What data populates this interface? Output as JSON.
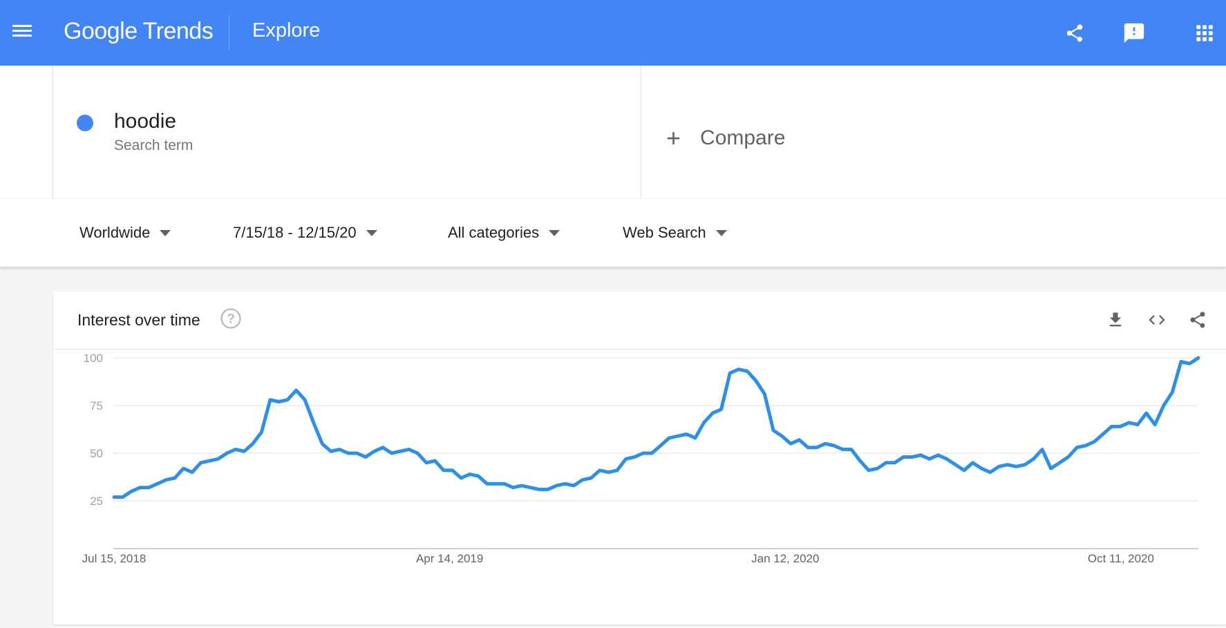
{
  "header": {
    "logo_google": "Google",
    "logo_trends": "Trends",
    "page_title": "Explore"
  },
  "search": {
    "term": "hoodie",
    "term_type": "Search term",
    "term_color": "#4285f4",
    "compare_label": "Compare",
    "compare_icon": "plus-icon"
  },
  "filters": {
    "location": "Worldwide",
    "date_range": "7/15/18 - 12/15/20",
    "category": "All categories",
    "search_type": "Web Search"
  },
  "card": {
    "title": "Interest over time",
    "icons": [
      "help-icon",
      "download-icon",
      "embed-code-icon",
      "share-icon"
    ]
  },
  "colors": {
    "header_bg": "#4285f4",
    "line": "#2d8fe6"
  },
  "chart_data": {
    "type": "line",
    "ylim": [
      0,
      100
    ],
    "y_ticks": [
      25,
      50,
      75,
      100
    ],
    "x_tick_labels": [
      "Jul 15, 2018",
      "Apr 14, 2019",
      "Jan 12, 2020",
      "Oct 11, 2020"
    ],
    "x_start": "2018-07-15",
    "x_end": "2020-12-13",
    "x_interval": "weekly",
    "grid": true,
    "series": [
      {
        "values": [
          27,
          27,
          30,
          32,
          32,
          34,
          36,
          37,
          42,
          40,
          45,
          46,
          47,
          50,
          52,
          51,
          55,
          61,
          78,
          77,
          78,
          83,
          78,
          66,
          55,
          51,
          52,
          50,
          50,
          48,
          51,
          53,
          50,
          51,
          52,
          50,
          45,
          46,
          41,
          41,
          37,
          39,
          38,
          34,
          34,
          34,
          32,
          33,
          32,
          31,
          31,
          33,
          34,
          33,
          36,
          37,
          41,
          40,
          41,
          47,
          48,
          50,
          50,
          54,
          58,
          59,
          60,
          58,
          66,
          71,
          73,
          92,
          94,
          93,
          88,
          81,
          62,
          59,
          55,
          57,
          53,
          53,
          55,
          54,
          52,
          52,
          46,
          41,
          42,
          45,
          45,
          48,
          48,
          49,
          47,
          49,
          47,
          44,
          41,
          45,
          42,
          40,
          43,
          44,
          43,
          44,
          47,
          52,
          42,
          45,
          48,
          53,
          54,
          56,
          60,
          64,
          64,
          66,
          65,
          71,
          65,
          75,
          82,
          98,
          97,
          100
        ]
      }
    ]
  }
}
